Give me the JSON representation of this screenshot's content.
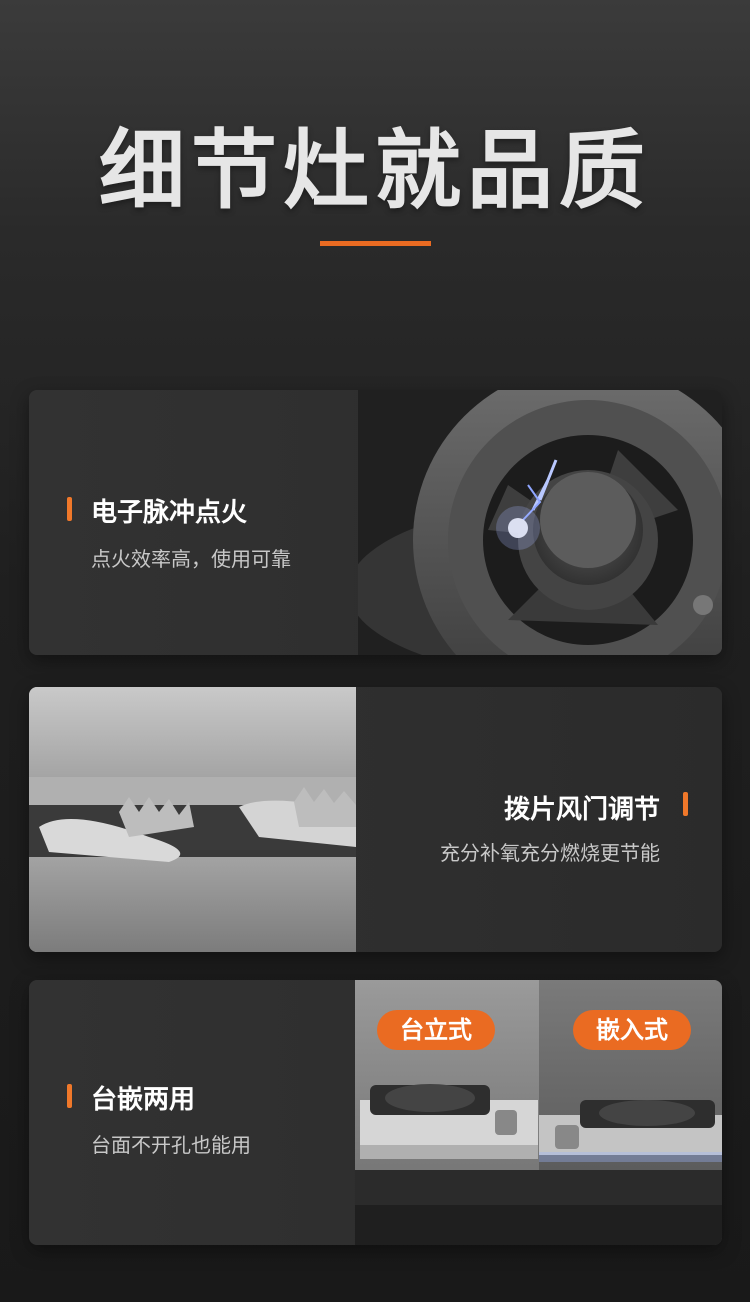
{
  "header": {
    "title": "细节灶就品质"
  },
  "features": [
    {
      "title": "电子脉冲点火",
      "subtitle": "点火效率高，使用可靠"
    },
    {
      "title": "拨片风门调节",
      "subtitle": "充分补氧充分燃烧更节能"
    },
    {
      "title": "台嵌两用",
      "subtitle": "台面不开孔也能用",
      "tags": [
        "台立式",
        "嵌入式"
      ]
    }
  ],
  "colors": {
    "accent": "#ea6b22",
    "background": "#1f1f1f",
    "card": "#2e2e2e"
  },
  "icons": {
    "marker": "orange-bar-marker"
  }
}
